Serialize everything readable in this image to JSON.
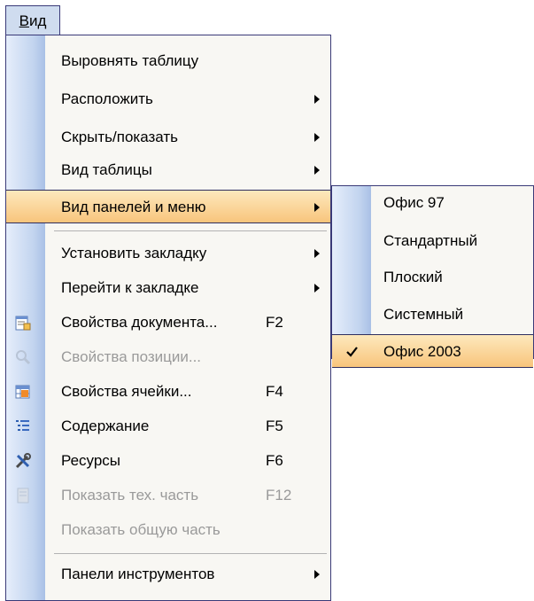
{
  "menubar": {
    "menu_title_first": "В",
    "menu_title_rest": "ид"
  },
  "main_menu": {
    "items": [
      {
        "label": "Выровнять таблицу"
      },
      {
        "label": "Расположить"
      },
      {
        "label": "Скрыть/показать"
      },
      {
        "label": "Вид таблицы"
      },
      {
        "label": "Вид панелей и меню"
      },
      {
        "label": "Установить закладку"
      },
      {
        "label": "Перейти к закладке"
      },
      {
        "label": "Свойства документа...",
        "shortcut": "F2"
      },
      {
        "label": "Свойства позиции..."
      },
      {
        "label": "Свойства ячейки...",
        "shortcut": "F4"
      },
      {
        "label": "Содержание",
        "shortcut": "F5"
      },
      {
        "label": "Ресурсы",
        "shortcut": "F6"
      },
      {
        "label": "Показать тех. часть",
        "shortcut": "F12"
      },
      {
        "label": "Показать общую часть"
      },
      {
        "label": "Панели инструментов"
      }
    ]
  },
  "sub_menu": {
    "items": [
      {
        "label": "Офис 97"
      },
      {
        "label": "Стандартный"
      },
      {
        "label": "Плоский"
      },
      {
        "label": "Системный"
      },
      {
        "label": "Офис 2003",
        "checked": true
      }
    ]
  },
  "icons": {
    "item7": "document-properties-icon",
    "item8": "position-properties-icon",
    "item9": "cell-properties-icon",
    "item10": "contents-icon",
    "item11": "resources-tools-icon",
    "item12": "technical-part-icon",
    "checkmark": "checkmark-icon"
  },
  "colors": {
    "highlight_top": "#fde9bd",
    "highlight_bottom": "#f8c57c",
    "menu_border": "#3a3a78",
    "disabled_text": "#9a9a9a"
  }
}
